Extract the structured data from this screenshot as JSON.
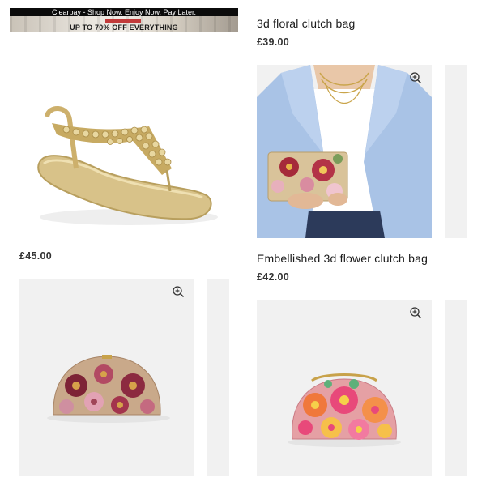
{
  "banner": {
    "promo_text": "Clearpay - Shop Now. Enjoy Now. Pay Later.",
    "sale_text": "UP TO 70% OFF EVERYTHING"
  },
  "products": [
    {
      "name": "",
      "price": "£45.00",
      "image_icon": "gold-studded-sandal-icon"
    },
    {
      "name": "3d floral clutch bag",
      "price": "£39.00",
      "image_icon": "floral-clutch-model-icon"
    },
    {
      "name": "",
      "price": "",
      "image_icon": "embroidered-clutch-icon"
    },
    {
      "name": "Embellished 3d flower clutch bag",
      "price": "£42.00",
      "image_icon": "flower-clutch-icon"
    }
  ],
  "colors": {
    "card_bg": "#f1f1f1",
    "sale_red": "#c23b3b",
    "blazer_blue": "#a9c3e6",
    "sandal_gold": "#d8c289"
  }
}
